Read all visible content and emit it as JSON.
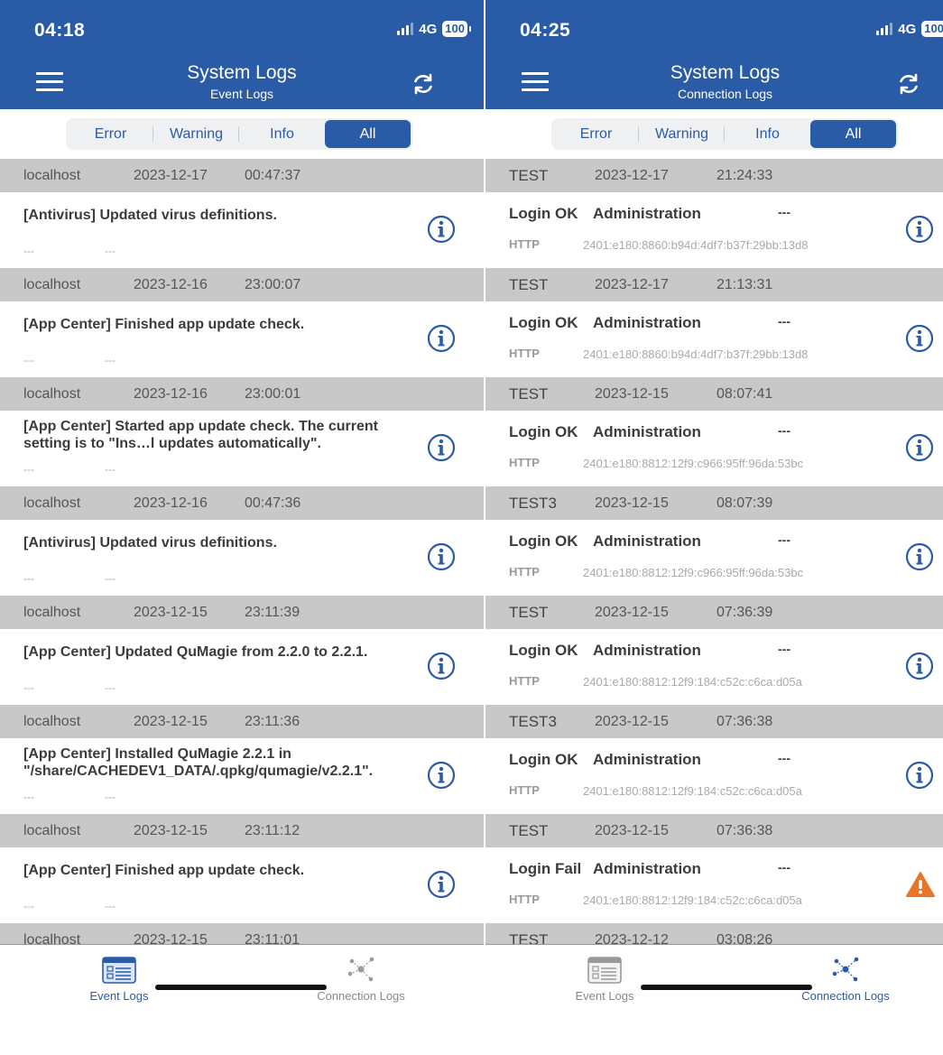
{
  "colors": {
    "brand": "#2a5ba7",
    "group_header": "#c8c8c8",
    "warning": "#e8762a"
  },
  "left": {
    "status": {
      "time": "04:18",
      "network": "4G",
      "battery": "100"
    },
    "header": {
      "title": "System Logs",
      "subtitle": "Event Logs"
    },
    "filters": [
      "Error",
      "Warning",
      "Info",
      "All"
    ],
    "active_filter": "All",
    "groups": [
      {
        "host": "localhost",
        "date": "2023-12-17",
        "time": "00:47:37",
        "message": "[Antivirus] Updated virus definitions.",
        "sub1": "---",
        "sub2": "---",
        "icon": "info-icon"
      },
      {
        "host": "localhost",
        "date": "2023-12-16",
        "time": "23:00:07",
        "message": "[App Center] Finished app update check.",
        "sub1": "---",
        "sub2": "---",
        "icon": "info-icon"
      },
      {
        "host": "localhost",
        "date": "2023-12-16",
        "time": "23:00:01",
        "message": "[App Center] Started app update check. The current setting is to \"Ins…l updates automatically\".",
        "sub1": "---",
        "sub2": "---",
        "icon": "info-icon"
      },
      {
        "host": "localhost",
        "date": "2023-12-16",
        "time": "00:47:36",
        "message": "[Antivirus] Updated virus definitions.",
        "sub1": "---",
        "sub2": "---",
        "icon": "info-icon"
      },
      {
        "host": "localhost",
        "date": "2023-12-15",
        "time": "23:11:39",
        "message": "[App Center] Updated QuMagie from 2.2.0 to 2.2.1.",
        "sub1": "---",
        "sub2": "---",
        "icon": "info-icon"
      },
      {
        "host": "localhost",
        "date": "2023-12-15",
        "time": "23:11:36",
        "message": "[App Center] Installed QuMagie 2.2.1 in \"/share/CACHEDEV1_DATA/.qpkg/qumagie/v2.2.1\".",
        "sub1": "---",
        "sub2": "---",
        "icon": "info-icon"
      },
      {
        "host": "localhost",
        "date": "2023-12-15",
        "time": "23:11:12",
        "message": "[App Center] Finished app update check.",
        "sub1": "---",
        "sub2": "---",
        "icon": "info-icon"
      }
    ],
    "partial_group": {
      "host": "localhost",
      "date": "2023-12-15",
      "time": "23:11:01"
    },
    "tabs": [
      {
        "label": "Event Logs",
        "icon": "calendar-list-icon",
        "active": true
      },
      {
        "label": "Connection Logs",
        "icon": "network-nodes-icon",
        "active": false
      }
    ]
  },
  "right": {
    "status": {
      "time": "04:25",
      "network": "4G",
      "battery": "100"
    },
    "header": {
      "title": "System Logs",
      "subtitle": "Connection Logs"
    },
    "filters": [
      "Error",
      "Warning",
      "Info",
      "All"
    ],
    "active_filter": "All",
    "groups": [
      {
        "host": "TEST",
        "date": "2023-12-17",
        "time": "21:24:33",
        "status": "Login OK",
        "user": "Administration",
        "dash": "---",
        "protocol": "HTTP",
        "ip": "2401:e180:8860:b94d:4df7:b37f:29bb:13d8",
        "icon": "info-icon"
      },
      {
        "host": "TEST",
        "date": "2023-12-17",
        "time": "21:13:31",
        "status": "Login OK",
        "user": "Administration",
        "dash": "---",
        "protocol": "HTTP",
        "ip": "2401:e180:8860:b94d:4df7:b37f:29bb:13d8",
        "icon": "info-icon"
      },
      {
        "host": "TEST",
        "date": "2023-12-15",
        "time": "08:07:41",
        "status": "Login OK",
        "user": "Administration",
        "dash": "---",
        "protocol": "HTTP",
        "ip": "2401:e180:8812:12f9:c966:95ff:96da:53bc",
        "icon": "info-icon"
      },
      {
        "host": "TEST3",
        "date": "2023-12-15",
        "time": "08:07:39",
        "status": "Login OK",
        "user": "Administration",
        "dash": "---",
        "protocol": "HTTP",
        "ip": "2401:e180:8812:12f9:c966:95ff:96da:53bc",
        "icon": "info-icon"
      },
      {
        "host": "TEST",
        "date": "2023-12-15",
        "time": "07:36:39",
        "status": "Login OK",
        "user": "Administration",
        "dash": "---",
        "protocol": "HTTP",
        "ip": "2401:e180:8812:12f9:184:c52c:c6ca:d05a",
        "icon": "info-icon"
      },
      {
        "host": "TEST3",
        "date": "2023-12-15",
        "time": "07:36:38",
        "status": "Login OK",
        "user": "Administration",
        "dash": "---",
        "protocol": "HTTP",
        "ip": "2401:e180:8812:12f9:184:c52c:c6ca:d05a",
        "icon": "info-icon"
      },
      {
        "host": "TEST",
        "date": "2023-12-15",
        "time": "07:36:38",
        "status": "Login Fail",
        "user": "Administration",
        "dash": "---",
        "protocol": "HTTP",
        "ip": "2401:e180:8812:12f9:184:c52c:c6ca:d05a",
        "icon": "warning-icon"
      }
    ],
    "partial_group": {
      "host": "TEST",
      "date": "2023-12-12",
      "time": "03:08:26"
    },
    "tabs": [
      {
        "label": "Event Logs",
        "icon": "calendar-list-icon",
        "active": false
      },
      {
        "label": "Connection Logs",
        "icon": "network-nodes-icon",
        "active": true
      }
    ]
  }
}
